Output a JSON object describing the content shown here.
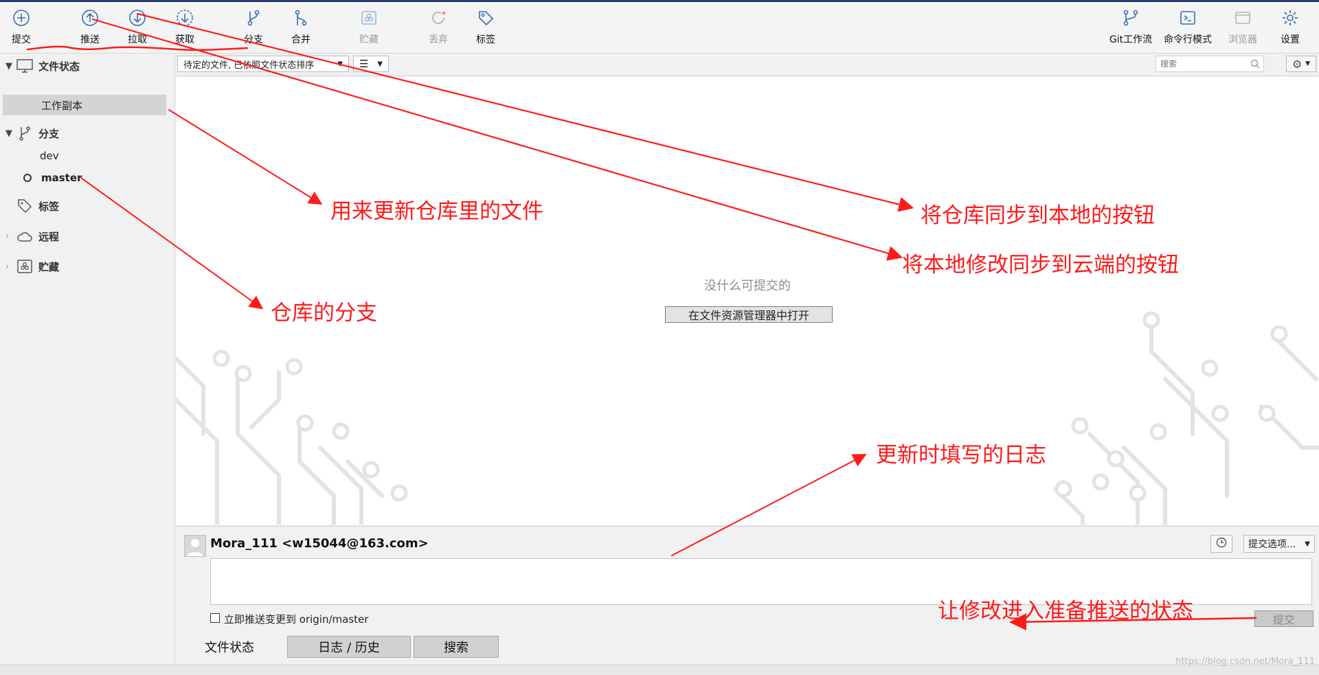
{
  "toolbar": {
    "commit": "提交",
    "push": "推送",
    "pull": "拉取",
    "fetch": "获取",
    "branch": "分支",
    "merge": "合并",
    "stash": "贮藏",
    "discard": "丢弃",
    "tag": "标签",
    "gitflow": "Git工作流",
    "terminal": "命令行模式",
    "browser": "浏览器",
    "settings": "设置"
  },
  "sidebar": {
    "file_status": "文件状态",
    "working_copy": "工作副本",
    "branches": "分支",
    "branch_items": [
      "dev",
      "master"
    ],
    "tags": "标签",
    "remotes": "远程",
    "stashes": "贮藏"
  },
  "filter": {
    "sort_label": "待定的文件, 已依照文件状态排序",
    "search_placeholder": "搜索"
  },
  "main": {
    "empty_message": "没什么可提交的",
    "open_explorer": "在文件资源管理器中打开"
  },
  "commit_panel": {
    "author": "Mora_111 <w15044@163.com>",
    "push_immediately": "立即推送变更到 origin/master",
    "options": "提交选项...",
    "submit": "提交"
  },
  "tabs": [
    "文件状态",
    "日志 / 历史",
    "搜索"
  ],
  "annotations": {
    "update_files": "用来更新仓库里的文件",
    "sync_to_local": "将仓库同步到本地的按钮",
    "push_to_cloud": "将本地修改同步到云端的按钮",
    "branches": "仓库的分支",
    "commit_log": "更新时填写的日志",
    "stage_changes": "让修改进入准备推送的状态"
  },
  "watermark": "https://blog.csdn.net/Mora_111",
  "colors": {
    "accent": "#2f6db5",
    "annotation": "#ff1a1a",
    "toolbar_bg": "#f4f4f4"
  }
}
